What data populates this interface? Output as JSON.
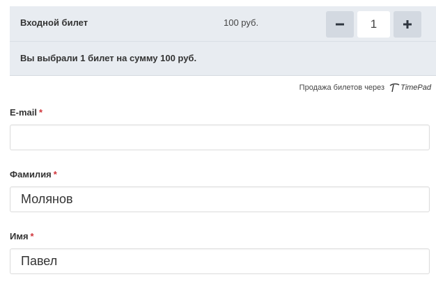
{
  "ticket": {
    "name": "Входной билет",
    "price": "100 руб.",
    "quantity": "1",
    "summary": "Вы выбрали 1 билет на сумму 100 руб."
  },
  "powered_by": {
    "text": "Продажа билетов через",
    "brand": "TimePad"
  },
  "form": {
    "required_mark": "*",
    "email": {
      "label": "E-mail",
      "value": ""
    },
    "last_name": {
      "label": "Фамилия",
      "value": "Молянов"
    },
    "first_name": {
      "label": "Имя",
      "value": "Павел"
    }
  },
  "colors": {
    "panel_bg": "#e8ecf1",
    "button_bg": "#d3d9e1",
    "required": "#d0343a"
  }
}
